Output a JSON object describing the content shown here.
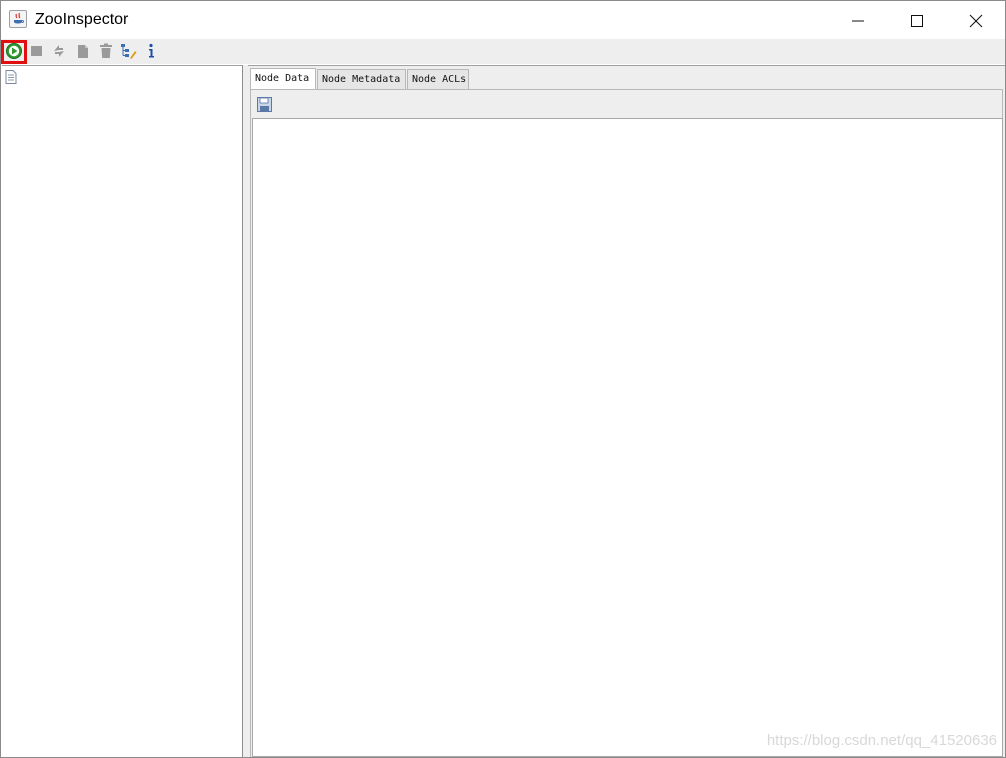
{
  "window": {
    "title": "ZooInspector"
  },
  "toolbar": {
    "items": [
      {
        "name": "connect",
        "icon": "play-circle-icon",
        "enabled": true,
        "highlighted": true
      },
      {
        "name": "disconnect",
        "icon": "stop-icon",
        "enabled": false
      },
      {
        "name": "refresh",
        "icon": "refresh-icon",
        "enabled": false
      },
      {
        "name": "add-node",
        "icon": "add-node-icon",
        "enabled": false
      },
      {
        "name": "delete-node",
        "icon": "trash-icon",
        "enabled": false
      },
      {
        "name": "node-viewers",
        "icon": "tree-edit-icon",
        "enabled": true
      },
      {
        "name": "about",
        "icon": "info-icon",
        "enabled": true
      }
    ]
  },
  "tree": {
    "root_icon": "document-icon"
  },
  "tabs": [
    {
      "label": "Node Data",
      "active": true
    },
    {
      "label": "Node Metadata",
      "active": false
    },
    {
      "label": "Node ACLs",
      "active": false
    }
  ],
  "node_data": {
    "save_icon": "floppy-disk-icon",
    "content": ""
  },
  "watermark": "https://blog.csdn.net/qq_41520636",
  "colors": {
    "highlight_border": "#e01010",
    "connect_green": "#2e9a2e",
    "info_blue": "#1a4fa8"
  }
}
